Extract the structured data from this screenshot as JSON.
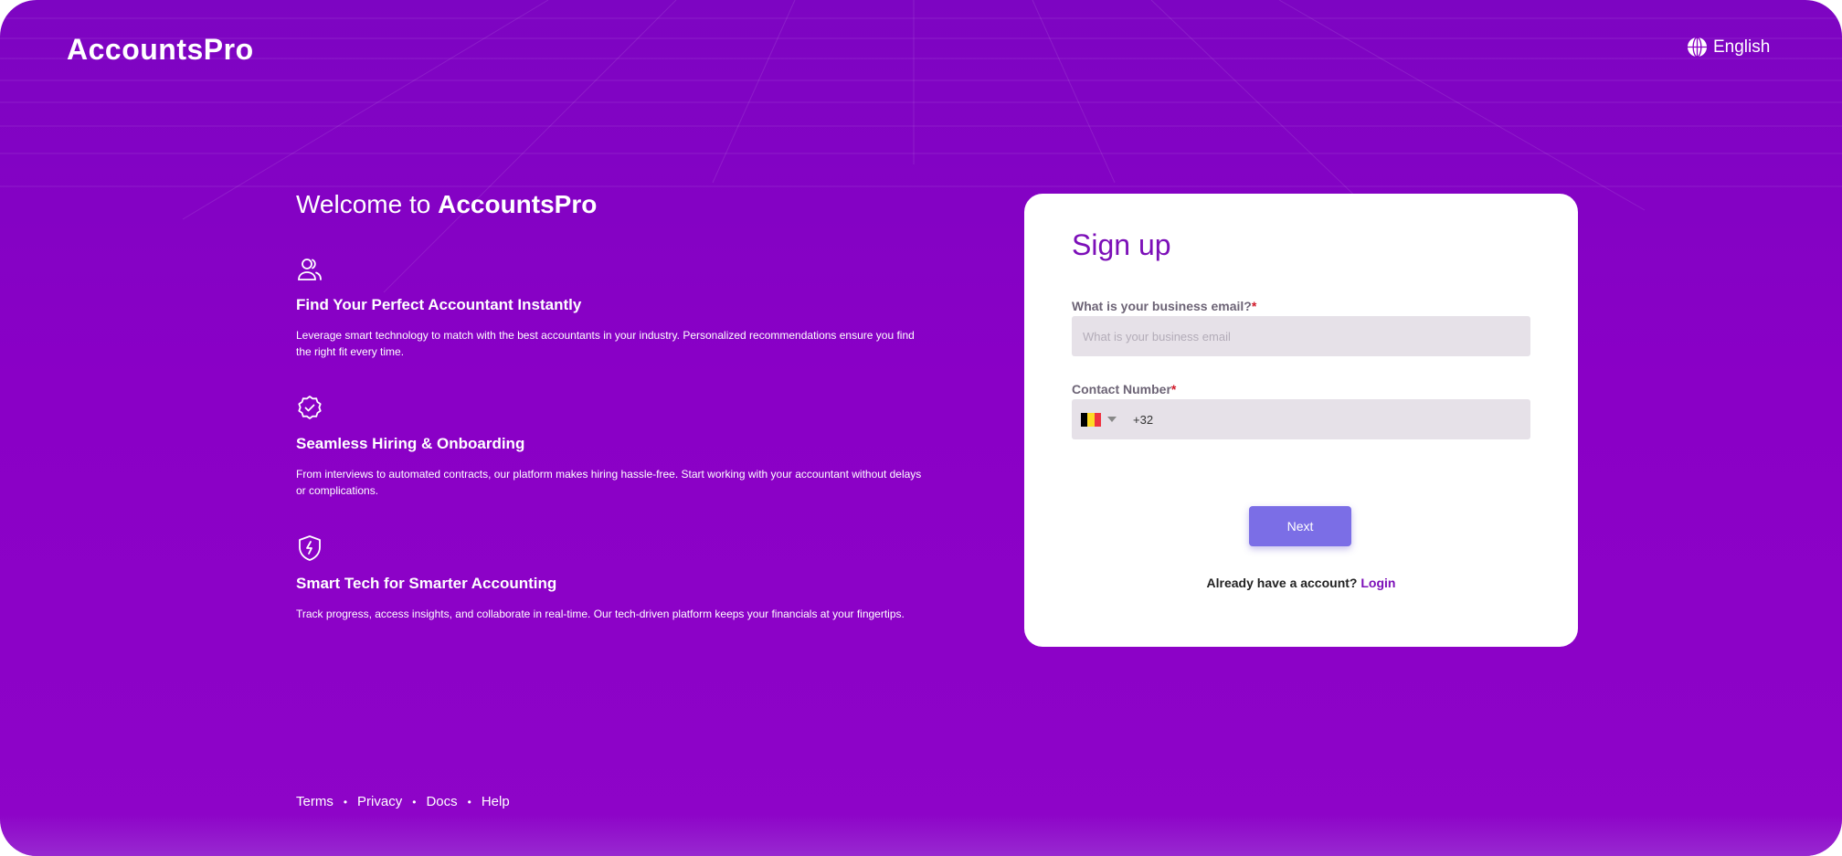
{
  "brand": {
    "logo_text": "AccountsPro"
  },
  "header": {
    "language_label": "English"
  },
  "hero": {
    "welcome_prefix": "Welcome to ",
    "welcome_brand": "AccountsPro",
    "features": [
      {
        "icon": "users-icon",
        "title": "Find Your Perfect Accountant Instantly",
        "description": "Leverage smart technology to match with the best accountants in your industry. Personalized recommendations ensure you find the right fit every time."
      },
      {
        "icon": "verified-badge-icon",
        "title": "Seamless Hiring & Onboarding",
        "description": "From interviews to automated contracts, our platform makes hiring hassle-free. Start working with your accountant without delays or complications."
      },
      {
        "icon": "shield-bolt-icon",
        "title": "Smart Tech for Smarter Accounting",
        "description": "Track progress, access insights, and collaborate in real-time. Our tech-driven platform keeps your financials at your fingertips."
      }
    ]
  },
  "signup": {
    "title": "Sign up",
    "email_label": "What is your business email?",
    "email_required_mark": "*",
    "email_placeholder": "What is your business email",
    "email_value": "",
    "phone_label": "Contact Number",
    "phone_required_mark": "*",
    "phone_country": "Belgium",
    "phone_dial_code": "+32",
    "next_label": "Next",
    "login_prompt": "Already have a account?",
    "login_link": "Login"
  },
  "footer": {
    "links": [
      "Terms",
      "Privacy",
      "Docs",
      "Help"
    ],
    "separator": "•"
  },
  "colors": {
    "background": "#8a00c6",
    "accent_purple": "#7c0fb8",
    "button": "#7b6ee6",
    "input_bg": "#e6e1e8",
    "required": "#d11a2a",
    "flag_black": "#000000",
    "flag_yellow": "#fdda24",
    "flag_red": "#ef3340"
  }
}
